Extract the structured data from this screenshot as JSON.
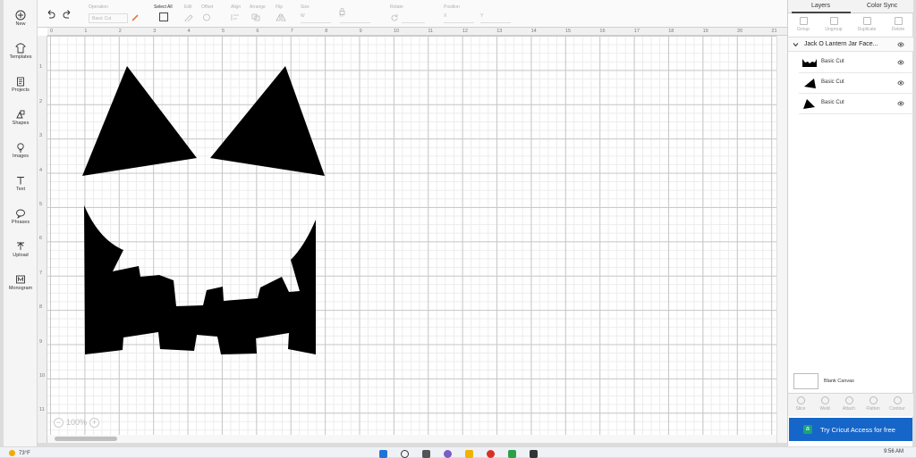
{
  "leftnav": {
    "items": [
      {
        "label": "New",
        "icon": "plus-circle-icon"
      },
      {
        "label": "Templates",
        "icon": "shirt-icon"
      },
      {
        "label": "Projects",
        "icon": "clipboard-icon"
      },
      {
        "label": "Shapes",
        "icon": "shapes-icon"
      },
      {
        "label": "Images",
        "icon": "lightbulb-icon"
      },
      {
        "label": "Text",
        "icon": "text-icon"
      },
      {
        "label": "Phrases",
        "icon": "speech-bubble-icon"
      },
      {
        "label": "Upload",
        "icon": "upload-icon"
      },
      {
        "label": "Monogram",
        "icon": "monogram-icon"
      }
    ]
  },
  "toolbar": {
    "operation_header": "Operation",
    "operation_value": "Basic Cut",
    "select_all": "Select All",
    "edit": "Edit",
    "offset": "Offset",
    "align": "Align",
    "arrange": "Arrange",
    "flip": "Flip",
    "size": "Size",
    "size_w": "W",
    "size_h": "H",
    "rotate": "Rotate",
    "position": "Position",
    "pos_x": "X",
    "pos_y": "Y"
  },
  "ruler": {
    "top": [
      "0",
      "1",
      "2",
      "3",
      "4",
      "5",
      "6",
      "7",
      "8",
      "9",
      "10",
      "11",
      "12",
      "13",
      "14",
      "15",
      "16",
      "17",
      "18",
      "19",
      "20",
      "21"
    ],
    "left": [
      "1",
      "2",
      "3",
      "4",
      "5",
      "6",
      "7",
      "8",
      "9",
      "10",
      "11"
    ]
  },
  "zoom": {
    "minus": "−",
    "value": "100%",
    "plus": "+"
  },
  "panel": {
    "tabs": [
      "Layers",
      "Color Sync"
    ],
    "actions": [
      "Group",
      "Ungroup",
      "Duplicate",
      "Delete"
    ],
    "group_name": "Jack O Lantern Jar Face...",
    "layers": [
      {
        "name": "Basic Cut",
        "thumb": "mouth"
      },
      {
        "name": "Basic Cut",
        "thumb": "triangle-right"
      },
      {
        "name": "Basic Cut",
        "thumb": "triangle-left"
      }
    ],
    "blank_canvas": "Blank Canvas",
    "bottom_actions": [
      "Slice",
      "Weld",
      "Attach",
      "Flatten",
      "Contour"
    ],
    "access_button": "Try Cricut Access for free",
    "access_icon": "a"
  },
  "taskbar": {
    "weather": "73°F",
    "clock": "9:56 AM"
  },
  "colors": {
    "shape_fill": "#000000",
    "access_blue": "#1566c8",
    "access_icon_green": "#19a37a"
  }
}
